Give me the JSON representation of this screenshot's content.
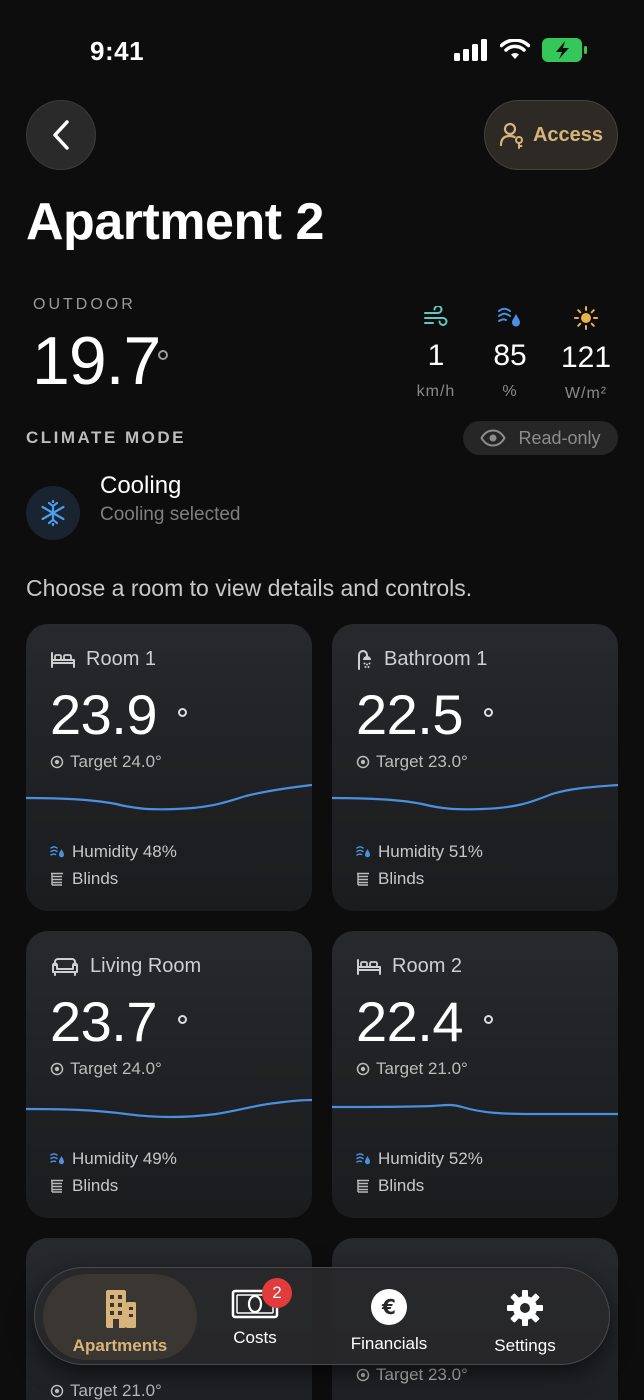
{
  "status_bar": {
    "time": "9:41"
  },
  "header": {
    "access_label": "Access",
    "title": "Apartment 2"
  },
  "outdoor": {
    "label": "OUTDOOR",
    "temperature": "19.7",
    "metrics": [
      {
        "icon": "wind-icon",
        "value": "1",
        "unit": "km/h",
        "color": "#5fc9c1"
      },
      {
        "icon": "humidity-icon",
        "value": "85",
        "unit": "%",
        "color": "#4a8fe0"
      },
      {
        "icon": "sun-icon",
        "value": "121",
        "unit": "W/m²",
        "color": "#e6b24a"
      }
    ]
  },
  "climate": {
    "label": "CLIMATE MODE",
    "readonly_label": "Read-only",
    "mode": "Cooling",
    "mode_sub": "Cooling selected"
  },
  "hint": "Choose a room to view details and controls.",
  "rooms": [
    {
      "name": "Room 1",
      "icon": "bed-icon",
      "temp": "23.9",
      "target": "Target 24.0°",
      "humidity": "Humidity 48%",
      "blinds": "Blinds"
    },
    {
      "name": "Bathroom 1",
      "icon": "shower-icon",
      "temp": "22.5",
      "target": "Target 23.0°",
      "humidity": "Humidity 51%",
      "blinds": "Blinds"
    },
    {
      "name": "Living Room",
      "icon": "sofa-icon",
      "temp": "23.7",
      "target": "Target 24.0°",
      "humidity": "Humidity 49%",
      "blinds": "Blinds"
    },
    {
      "name": "Room 2",
      "icon": "bed-icon",
      "temp": "22.4",
      "target": "Target 21.0°",
      "humidity": "Humidity 52%",
      "blinds": "Blinds"
    }
  ],
  "partial_rooms": [
    {
      "target": "Target 21.0°"
    },
    {
      "target": "Target 23.0°"
    }
  ],
  "tabs": [
    {
      "label": "Apartments",
      "icon": "building-icon",
      "active": true
    },
    {
      "label": "Costs",
      "icon": "cash-icon",
      "badge": "2"
    },
    {
      "label": "Financials",
      "icon": "euro-icon"
    },
    {
      "label": "Settings",
      "icon": "gear-icon"
    }
  ],
  "colors": {
    "accent": "#d9b47a",
    "trend_line": "#4a8fe0",
    "badge": "#e23b3b",
    "battery": "#34c759"
  }
}
